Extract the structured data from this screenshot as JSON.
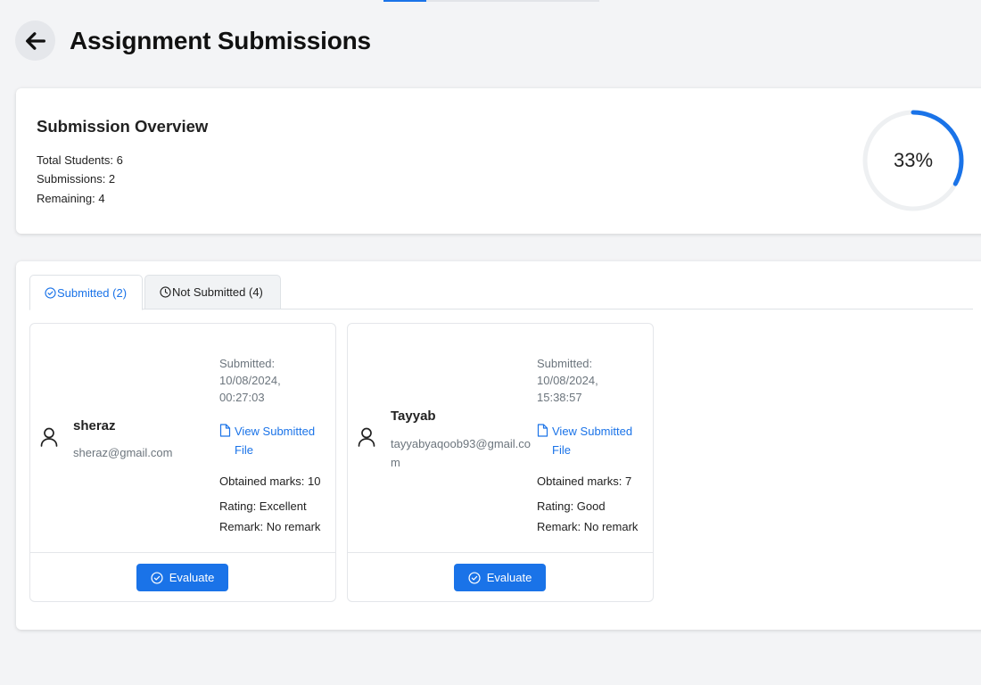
{
  "header": {
    "title": "Assignment Submissions",
    "back_icon": "arrow-left-icon"
  },
  "overview": {
    "title": "Submission Overview",
    "total_students": "Total Students: 6",
    "submissions": "Submissions: 2",
    "remaining": "Remaining: 4",
    "progress_value": 0.33,
    "progress_label": "33%",
    "accent_color": "#1a73e8"
  },
  "tabs": [
    {
      "label": "Submitted (2)",
      "icon": "check-circle-icon",
      "active": true
    },
    {
      "label": "Not Submitted (4)",
      "icon": "clock-icon",
      "active": false
    }
  ],
  "students": [
    {
      "name": "sheraz",
      "email": "sheraz@gmail.com",
      "submitted_label": "Submitted:",
      "submitted_date": "10/08/2024,",
      "submitted_time": "00:27:03",
      "view_link": "View Submitted File",
      "obtained_marks": "Obtained marks: 10",
      "rating": "Rating: Excellent",
      "remark": "Remark: No remark",
      "evaluate_label": "Evaluate"
    },
    {
      "name": "Tayyab",
      "email": "tayyabyaqoob93@gmail.com",
      "submitted_label": "Submitted:",
      "submitted_date": "10/08/2024,",
      "submitted_time": "15:38:57",
      "view_link": "View Submitted File",
      "obtained_marks": "Obtained marks: 7",
      "rating": "Rating: Good",
      "remark": "Remark: No remark",
      "evaluate_label": "Evaluate"
    }
  ]
}
